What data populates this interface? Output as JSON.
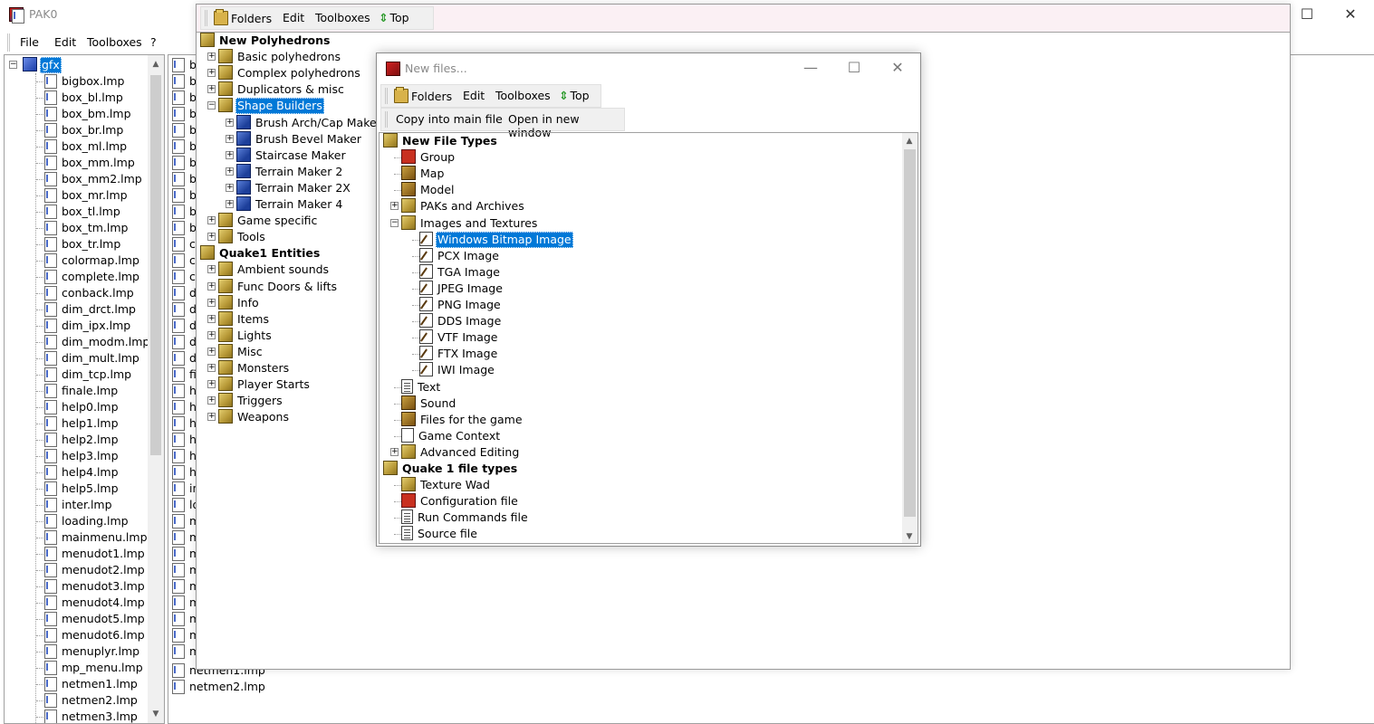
{
  "main_window": {
    "title": "PAK0",
    "menu": [
      "File",
      "Edit",
      "Toolboxes",
      "?"
    ],
    "tree_root": "gfx",
    "files": [
      "bigbox.lmp",
      "box_bl.lmp",
      "box_bm.lmp",
      "box_br.lmp",
      "box_ml.lmp",
      "box_mm.lmp",
      "box_mm2.lmp",
      "box_mr.lmp",
      "box_tl.lmp",
      "box_tm.lmp",
      "box_tr.lmp",
      "colormap.lmp",
      "complete.lmp",
      "conback.lmp",
      "dim_drct.lmp",
      "dim_ipx.lmp",
      "dim_modm.lmp",
      "dim_mult.lmp",
      "dim_tcp.lmp",
      "finale.lmp",
      "help0.lmp",
      "help1.lmp",
      "help2.lmp",
      "help3.lmp",
      "help4.lmp",
      "help5.lmp",
      "inter.lmp",
      "loading.lmp",
      "mainmenu.lmp",
      "menudot1.lmp",
      "menudot2.lmp",
      "menudot3.lmp",
      "menudot4.lmp",
      "menudot5.lmp",
      "menudot6.lmp",
      "menuplyr.lmp",
      "mp_menu.lmp",
      "netmen1.lmp",
      "netmen2.lmp",
      "netmen3.lmp"
    ],
    "right_list_visible": [
      "netmen1.lmp",
      "netmen2.lmp"
    ],
    "right_list_prefix": [
      "bi",
      "bo",
      "bo",
      "bo",
      "bo",
      "bo",
      "bo",
      "bo",
      "bo",
      "bo",
      "bo",
      "co",
      "co",
      "co",
      "di",
      "di",
      "di",
      "di",
      "di",
      "fi",
      "he",
      "he",
      "he",
      "he",
      "he",
      "he",
      "in",
      "lo",
      "m",
      "m",
      "m",
      "m",
      "m",
      "m",
      "m",
      "m",
      "m"
    ]
  },
  "toolbox_window": {
    "toolbar": {
      "folders": "Folders",
      "edit": "Edit",
      "toolboxes": "Toolboxes",
      "top": "Top"
    },
    "tree": [
      {
        "label": "New Polyhedrons",
        "level": 0,
        "bold": true,
        "icon": "box"
      },
      {
        "label": "Basic polyhedrons",
        "level": 1,
        "exp": "+",
        "icon": "box"
      },
      {
        "label": "Complex polyhedrons",
        "level": 1,
        "exp": "+",
        "icon": "box"
      },
      {
        "label": "Duplicators & misc",
        "level": 1,
        "exp": "+",
        "icon": "box"
      },
      {
        "label": "Shape Builders",
        "level": 1,
        "exp": "-",
        "icon": "box",
        "selected": true
      },
      {
        "label": "Brush Arch/Cap Maker",
        "level": 2,
        "exp": "+",
        "icon": "blue"
      },
      {
        "label": "Brush Bevel Maker",
        "level": 2,
        "exp": "+",
        "icon": "blue"
      },
      {
        "label": "Staircase Maker",
        "level": 2,
        "exp": "+",
        "icon": "blue"
      },
      {
        "label": "Terrain Maker 2",
        "level": 2,
        "exp": "+",
        "icon": "blue"
      },
      {
        "label": "Terrain Maker 2X",
        "level": 2,
        "exp": "+",
        "icon": "blue"
      },
      {
        "label": "Terrain Maker 4",
        "level": 2,
        "exp": "+",
        "icon": "blue"
      },
      {
        "label": "Game specific",
        "level": 1,
        "exp": "+",
        "icon": "box"
      },
      {
        "label": "Tools",
        "level": 1,
        "exp": "+",
        "icon": "box"
      },
      {
        "label": "Quake1 Entities",
        "level": 0,
        "bold": true,
        "icon": "box"
      },
      {
        "label": "Ambient sounds",
        "level": 1,
        "exp": "+",
        "icon": "box"
      },
      {
        "label": "Func Doors & lifts",
        "level": 1,
        "exp": "+",
        "icon": "box"
      },
      {
        "label": "Info",
        "level": 1,
        "exp": "+",
        "icon": "box"
      },
      {
        "label": "Items",
        "level": 1,
        "exp": "+",
        "icon": "box"
      },
      {
        "label": "Lights",
        "level": 1,
        "exp": "+",
        "icon": "box"
      },
      {
        "label": "Misc",
        "level": 1,
        "exp": "+",
        "icon": "box"
      },
      {
        "label": "Monsters",
        "level": 1,
        "exp": "+",
        "icon": "box"
      },
      {
        "label": "Player Starts",
        "level": 1,
        "exp": "+",
        "icon": "box"
      },
      {
        "label": "Triggers",
        "level": 1,
        "exp": "+",
        "icon": "box"
      },
      {
        "label": "Weapons",
        "level": 1,
        "exp": "+",
        "icon": "box"
      }
    ]
  },
  "new_files_window": {
    "title": "New files...",
    "toolbar": {
      "folders": "Folders",
      "edit": "Edit",
      "toolboxes": "Toolboxes",
      "top": "Top"
    },
    "toolbar2": {
      "copy": "Copy into main file",
      "open": "Open in new window"
    },
    "tree": [
      {
        "label": "New File Types",
        "level": 0,
        "bold": true,
        "icon": "box"
      },
      {
        "label": "Group",
        "level": 1,
        "icon": "group"
      },
      {
        "label": "Map",
        "level": 1,
        "icon": "map"
      },
      {
        "label": "Model",
        "level": 1,
        "icon": "map"
      },
      {
        "label": "PAKs and Archives",
        "level": 1,
        "exp": "+",
        "icon": "box"
      },
      {
        "label": "Images and Textures",
        "level": 1,
        "exp": "-",
        "icon": "box"
      },
      {
        "label": "Windows Bitmap Image",
        "level": 2,
        "icon": "img",
        "selected": true
      },
      {
        "label": "PCX Image",
        "level": 2,
        "icon": "img"
      },
      {
        "label": "TGA Image",
        "level": 2,
        "icon": "img"
      },
      {
        "label": "JPEG Image",
        "level": 2,
        "icon": "img"
      },
      {
        "label": "PNG Image",
        "level": 2,
        "icon": "img"
      },
      {
        "label": "DDS Image",
        "level": 2,
        "icon": "img"
      },
      {
        "label": "VTF Image",
        "level": 2,
        "icon": "img"
      },
      {
        "label": "FTX Image",
        "level": 2,
        "icon": "img"
      },
      {
        "label": "IWI Image",
        "level": 2,
        "icon": "img"
      },
      {
        "label": "Text",
        "level": 1,
        "icon": "file"
      },
      {
        "label": "Sound",
        "level": 1,
        "icon": "map"
      },
      {
        "label": "Files for the game",
        "level": 1,
        "icon": "map"
      },
      {
        "label": "Game Context",
        "level": 1,
        "icon": "ctx"
      },
      {
        "label": "Advanced Editing",
        "level": 1,
        "exp": "+",
        "icon": "box"
      },
      {
        "label": "Quake 1 file types",
        "level": 0,
        "bold": true,
        "icon": "box"
      },
      {
        "label": "Texture Wad",
        "level": 1,
        "icon": "box"
      },
      {
        "label": "Configuration file",
        "level": 1,
        "icon": "group"
      },
      {
        "label": "Run Commands file",
        "level": 1,
        "icon": "file"
      },
      {
        "label": "Source file",
        "level": 1,
        "icon": "file"
      }
    ]
  },
  "caption_buttons": {
    "minimize": "—",
    "maximize": "☐",
    "close": "✕"
  }
}
